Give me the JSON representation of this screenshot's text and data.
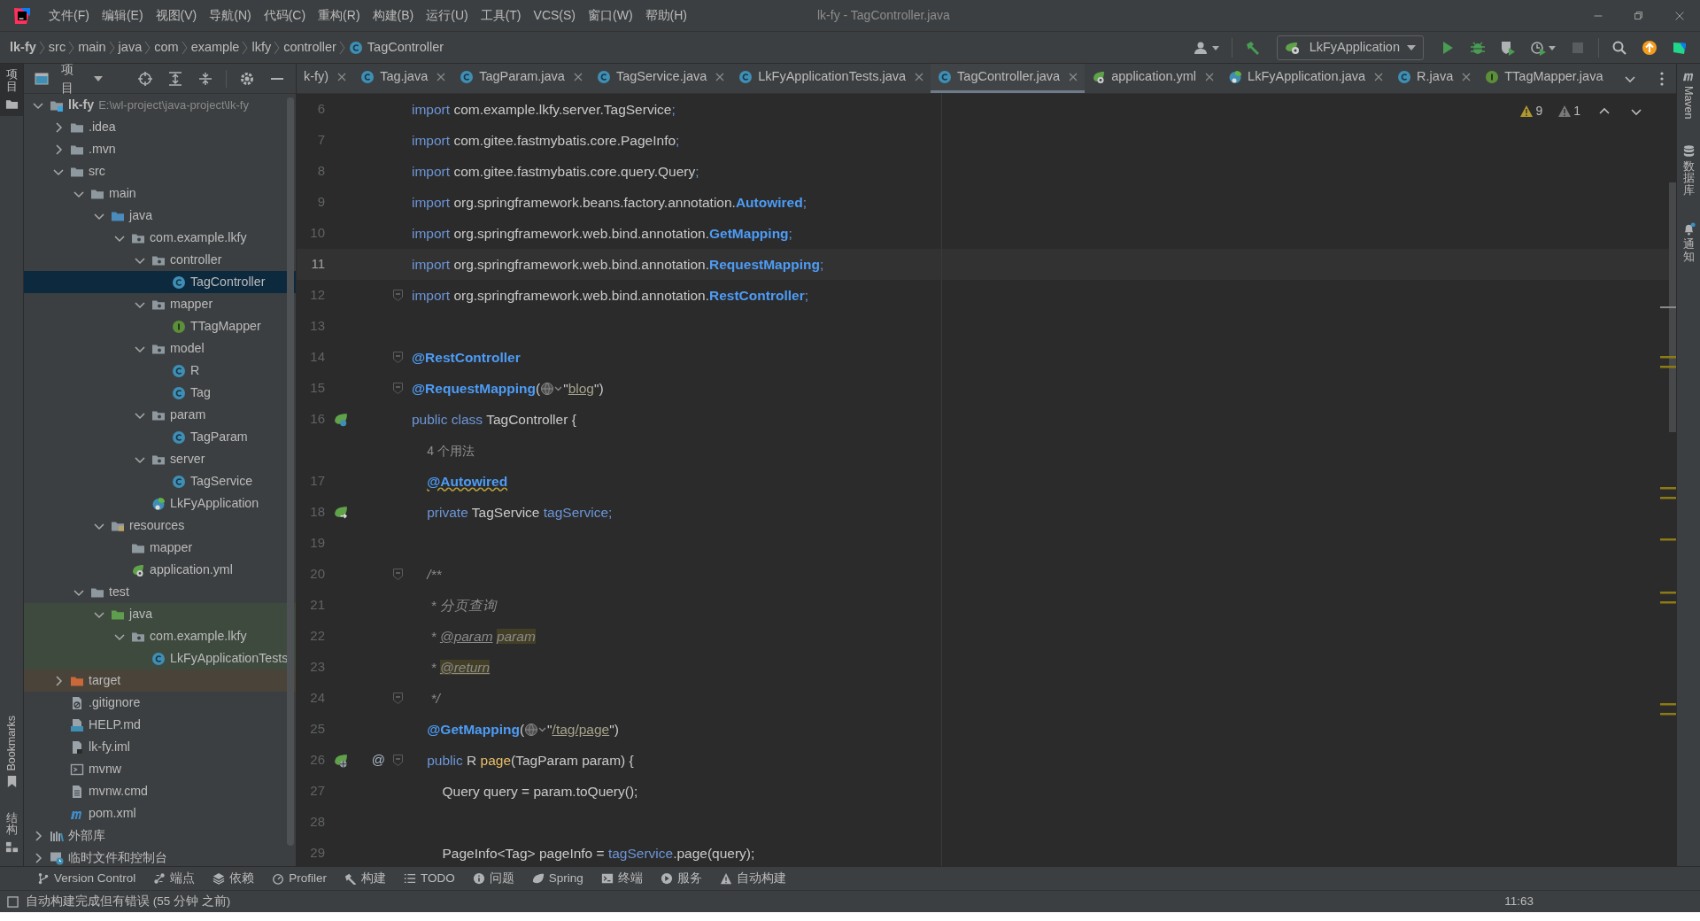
{
  "window": {
    "title": "lk-fy - TagController.java",
    "menu": [
      "文件(F)",
      "编辑(E)",
      "视图(V)",
      "导航(N)",
      "代码(C)",
      "重构(R)",
      "构建(B)",
      "运行(U)",
      "工具(T)",
      "VCS(S)",
      "窗口(W)",
      "帮助(H)"
    ]
  },
  "breadcrumb": [
    {
      "text": "lk-fy",
      "kind": "project"
    },
    {
      "text": "src",
      "kind": "plain"
    },
    {
      "text": "main",
      "kind": "plain"
    },
    {
      "text": "java",
      "kind": "plain"
    },
    {
      "text": "com",
      "kind": "plain"
    },
    {
      "text": "example",
      "kind": "plain"
    },
    {
      "text": "lkfy",
      "kind": "plain"
    },
    {
      "text": "controller",
      "kind": "plain"
    },
    {
      "text": "TagController",
      "kind": "class"
    }
  ],
  "toolbar": {
    "run_config": "LkFyApplication"
  },
  "left_strip": [
    {
      "label": "项目",
      "kind": "folder",
      "selected": true
    },
    {
      "label": "Bookmarks",
      "kind": "bookmark",
      "selected": false
    },
    {
      "label": "结构",
      "kind": "structure",
      "selected": false
    }
  ],
  "project_panel": {
    "title": "项目",
    "tree": [
      {
        "label": "lk-fy",
        "path": "E:\\wl-project\\java-project\\lk-fy",
        "kind": "project",
        "expanded": true,
        "selected": false,
        "children": [
          {
            "label": ".idea",
            "kind": "folder",
            "expanded": false,
            "selected": false
          },
          {
            "label": ".mvn",
            "kind": "folder",
            "expanded": false,
            "selected": false
          },
          {
            "label": "src",
            "kind": "folder",
            "expanded": true,
            "selected": false,
            "children": [
              {
                "label": "main",
                "kind": "folder",
                "expanded": true,
                "selected": false,
                "children": [
                  {
                    "label": "java",
                    "kind": "folder-source",
                    "expanded": true,
                    "selected": false,
                    "children": [
                      {
                        "label": "com.example.lkfy",
                        "kind": "package",
                        "expanded": true,
                        "selected": false,
                        "children": [
                          {
                            "label": "controller",
                            "kind": "package",
                            "expanded": true,
                            "selected": false,
                            "children": [
                              {
                                "label": "TagController",
                                "kind": "class",
                                "selected": true
                              }
                            ]
                          },
                          {
                            "label": "mapper",
                            "kind": "package",
                            "expanded": true,
                            "selected": false,
                            "children": [
                              {
                                "label": "TTagMapper",
                                "kind": "interface",
                                "selected": false
                              }
                            ]
                          },
                          {
                            "label": "model",
                            "kind": "package",
                            "expanded": true,
                            "selected": false,
                            "children": [
                              {
                                "label": "R",
                                "kind": "class",
                                "selected": false
                              },
                              {
                                "label": "Tag",
                                "kind": "class",
                                "selected": false
                              }
                            ]
                          },
                          {
                            "label": "param",
                            "kind": "package",
                            "expanded": true,
                            "selected": false,
                            "children": [
                              {
                                "label": "TagParam",
                                "kind": "class",
                                "selected": false
                              }
                            ]
                          },
                          {
                            "label": "server",
                            "kind": "package",
                            "expanded": true,
                            "selected": false,
                            "children": [
                              {
                                "label": "TagService",
                                "kind": "class",
                                "selected": false
                              }
                            ]
                          },
                          {
                            "label": "LkFyApplication",
                            "kind": "spring-class",
                            "selected": false
                          }
                        ]
                      }
                    ]
                  },
                  {
                    "label": "resources",
                    "kind": "resources",
                    "expanded": true,
                    "selected": false,
                    "children": [
                      {
                        "label": "mapper",
                        "kind": "folder",
                        "selected": false
                      },
                      {
                        "label": "application.yml",
                        "kind": "yml",
                        "selected": false
                      }
                    ]
                  }
                ]
              },
              {
                "label": "test",
                "kind": "folder",
                "expanded": true,
                "selected": false,
                "children": [
                  {
                    "label": "java",
                    "kind": "folder-test",
                    "expanded": true,
                    "selected": false,
                    "children": [
                      {
                        "label": "com.example.lkfy",
                        "kind": "package-test",
                        "expanded": true,
                        "selected": false,
                        "children": [
                          {
                            "label": "LkFyApplicationTests",
                            "kind": "class-test",
                            "selected": false
                          }
                        ]
                      }
                    ]
                  }
                ]
              }
            ]
          },
          {
            "label": "target",
            "kind": "folder-excluded",
            "expanded": false,
            "selected": false
          },
          {
            "label": ".gitignore",
            "kind": "gitignore",
            "selected": false
          },
          {
            "label": "HELP.md",
            "kind": "md",
            "selected": false
          },
          {
            "label": "lk-fy.iml",
            "kind": "iml",
            "selected": false
          },
          {
            "label": "mvnw",
            "kind": "shell",
            "selected": false
          },
          {
            "label": "mvnw.cmd",
            "kind": "text",
            "selected": false
          },
          {
            "label": "pom.xml",
            "kind": "maven",
            "selected": false
          }
        ]
      },
      {
        "label": "外部库",
        "kind": "library",
        "expanded": false,
        "selected": false
      },
      {
        "label": "临时文件和控制台",
        "kind": "scratch",
        "expanded": false,
        "selected": false
      }
    ]
  },
  "editor_tabs": [
    {
      "label": "k-fy)",
      "kind": "plain",
      "selected": false,
      "closable": true
    },
    {
      "label": "Tag.java",
      "kind": "class",
      "selected": false,
      "closable": true
    },
    {
      "label": "TagParam.java",
      "kind": "class",
      "selected": false,
      "closable": true
    },
    {
      "label": "TagService.java",
      "kind": "class",
      "selected": false,
      "closable": true
    },
    {
      "label": "LkFyApplicationTests.java",
      "kind": "class",
      "selected": false,
      "closable": true
    },
    {
      "label": "TagController.java",
      "kind": "class",
      "selected": true,
      "closable": true
    },
    {
      "label": "application.yml",
      "kind": "yml",
      "selected": false,
      "closable": true
    },
    {
      "label": "LkFyApplication.java",
      "kind": "spring-class",
      "selected": false,
      "closable": true
    },
    {
      "label": "R.java",
      "kind": "class",
      "selected": false,
      "closable": true
    },
    {
      "label": "TTagMapper.java",
      "kind": "interface",
      "selected": false,
      "closable": false
    }
  ],
  "inspections": {
    "warnings": "9",
    "weak_warnings": "1"
  },
  "code_lines": [
    {
      "number": "6",
      "current": false,
      "fold": false,
      "tokens": [
        {
          "kind": "keyword",
          "text": "import "
        },
        {
          "kind": "plain",
          "text": "com.example.lkfy.server.TagService"
        },
        {
          "kind": "keyword",
          "text": ";"
        }
      ]
    },
    {
      "number": "7",
      "current": false,
      "fold": false,
      "tokens": [
        {
          "kind": "keyword",
          "text": "import "
        },
        {
          "kind": "plain",
          "text": "com.gitee.fastmybatis.core.PageInfo"
        },
        {
          "kind": "keyword",
          "text": ";"
        }
      ]
    },
    {
      "number": "8",
      "current": false,
      "fold": false,
      "tokens": [
        {
          "kind": "keyword",
          "text": "import "
        },
        {
          "kind": "plain",
          "text": "com.gitee.fastmybatis.core.query.Query"
        },
        {
          "kind": "keyword",
          "text": ";"
        }
      ]
    },
    {
      "number": "9",
      "current": false,
      "fold": false,
      "tokens": [
        {
          "kind": "keyword",
          "text": "import "
        },
        {
          "kind": "plain",
          "text": "org.springframework.beans.factory.annotation."
        },
        {
          "kind": "annotation",
          "text": "Autowired"
        },
        {
          "kind": "keyword",
          "text": ";"
        }
      ]
    },
    {
      "number": "10",
      "current": false,
      "fold": false,
      "tokens": [
        {
          "kind": "keyword",
          "text": "import "
        },
        {
          "kind": "plain",
          "text": "org.springframework.web.bind.annotation."
        },
        {
          "kind": "annotation",
          "text": "GetMapping"
        },
        {
          "kind": "keyword",
          "text": ";"
        }
      ]
    },
    {
      "number": "11",
      "current": true,
      "fold": false,
      "tokens": [
        {
          "kind": "keyword",
          "text": "import "
        },
        {
          "kind": "plain",
          "text": "org.springframework.web.bind.annotation."
        },
        {
          "kind": "annotation",
          "text": "RequestMapping"
        },
        {
          "kind": "keyword",
          "text": ";"
        }
      ]
    },
    {
      "number": "12",
      "current": false,
      "fold": true,
      "tokens": [
        {
          "kind": "keyword",
          "text": "import "
        },
        {
          "kind": "plain",
          "text": "org.springframework.web.bind.annotation."
        },
        {
          "kind": "annotation",
          "text": "RestController"
        },
        {
          "kind": "keyword",
          "text": ";"
        }
      ]
    },
    {
      "number": "13",
      "current": false,
      "fold": false
    },
    {
      "number": "14",
      "current": false,
      "fold": true,
      "tokens": [
        {
          "kind": "annotation",
          "text": "@RestController"
        }
      ]
    },
    {
      "number": "15",
      "current": false,
      "fold": true,
      "tokens": [
        {
          "kind": "annotation",
          "text": "@RequestMapping"
        },
        {
          "kind": "plain",
          "text": "("
        },
        {
          "kind": "url-icon"
        },
        {
          "kind": "plain",
          "text": "\""
        },
        {
          "kind": "link",
          "text": "blog"
        },
        {
          "kind": "plain",
          "text": "\")"
        }
      ]
    },
    {
      "number": "16",
      "kind": "bean",
      "current": false,
      "fold": false,
      "tokens": [
        {
          "kind": "keyword",
          "text": "public class "
        },
        {
          "kind": "plain",
          "text": "TagController {"
        }
      ]
    },
    {
      "current": false,
      "fold": false,
      "tokens": [
        {
          "kind": "hint",
          "text": "    4 个用法"
        }
      ]
    },
    {
      "number": "17",
      "current": false,
      "fold": false,
      "tokens": [
        {
          "kind": "annotation-warn",
          "text": "    @Autowired"
        }
      ]
    },
    {
      "number": "18",
      "kind": "inject",
      "current": false,
      "fold": false,
      "tokens": [
        {
          "kind": "keyword",
          "text": "    private "
        },
        {
          "kind": "plain",
          "text": "TagService "
        },
        {
          "kind": "field",
          "text": "tagService"
        },
        {
          "kind": "keyword",
          "text": ";"
        }
      ]
    },
    {
      "number": "19",
      "current": false,
      "fold": false
    },
    {
      "number": "20",
      "current": false,
      "fold": true,
      "tokens": [
        {
          "kind": "comment",
          "text": "    /**"
        }
      ]
    },
    {
      "number": "21",
      "current": false,
      "fold": false,
      "tokens": [
        {
          "kind": "comment",
          "text": "     * 分页查询"
        }
      ]
    },
    {
      "number": "22",
      "current": false,
      "fold": false,
      "tokens": [
        {
          "kind": "comment",
          "text": "     * "
        },
        {
          "kind": "doctag",
          "text": "@param"
        },
        {
          "kind": "docparam",
          "text": " param"
        }
      ]
    },
    {
      "number": "23",
      "current": false,
      "fold": false,
      "tokens": [
        {
          "kind": "comment",
          "text": "     * "
        },
        {
          "kind": "doctag-marked",
          "text": "@return"
        }
      ]
    },
    {
      "number": "24",
      "current": false,
      "fold": true,
      "tokens": [
        {
          "kind": "comment",
          "text": "     */"
        }
      ]
    },
    {
      "number": "25",
      "current": false,
      "fold": false,
      "tokens": [
        {
          "kind": "annotation",
          "text": "    @GetMapping"
        },
        {
          "kind": "plain",
          "text": "("
        },
        {
          "kind": "url-icon"
        },
        {
          "kind": "plain",
          "text": "\""
        },
        {
          "kind": "link",
          "text": "/tag/page"
        },
        {
          "kind": "plain",
          "text": "\")"
        }
      ]
    },
    {
      "number": "26",
      "kind": "endpoint",
      "current": false,
      "fold": true,
      "marker": "@",
      "tokens": [
        {
          "kind": "keyword",
          "text": "    public "
        },
        {
          "kind": "plain",
          "text": "R "
        },
        {
          "kind": "method",
          "text": "page"
        },
        {
          "kind": "plain",
          "text": "(TagParam param) {"
        }
      ]
    },
    {
      "number": "27",
      "current": false,
      "fold": false,
      "tokens": [
        {
          "kind": "plain",
          "text": "        Query query = param.toQuery();"
        }
      ]
    },
    {
      "number": "28",
      "current": false,
      "fold": false
    },
    {
      "number": "29",
      "current": false,
      "fold": false,
      "tokens": [
        {
          "kind": "plain",
          "text": "        PageInfo<Tag> pageInfo = "
        },
        {
          "kind": "field",
          "text": "tagService"
        },
        {
          "kind": "plain",
          "text": ".page(query);"
        }
      ]
    }
  ],
  "right_strip": [
    {
      "label": "Maven",
      "kind": "maven",
      "badge": false
    },
    {
      "label": "数据库",
      "kind": "database",
      "badge": false
    },
    {
      "label": "通知",
      "kind": "bell",
      "badge": true
    }
  ],
  "tool_windows": [
    {
      "label": "Version Control",
      "kind": "branch"
    },
    {
      "label": "端点",
      "kind": "endpoints"
    },
    {
      "label": "依赖",
      "kind": "layers"
    },
    {
      "label": "Profiler",
      "kind": "gauge"
    },
    {
      "label": "构建",
      "kind": "hammer"
    },
    {
      "label": "TODO",
      "kind": "list"
    },
    {
      "label": "问题",
      "kind": "info"
    },
    {
      "label": "Spring",
      "kind": "leaf"
    },
    {
      "label": "终端",
      "kind": "terminal"
    },
    {
      "label": "服务",
      "kind": "play"
    },
    {
      "label": "自动构建",
      "kind": "warning"
    }
  ],
  "status_bar": {
    "message": "自动构建完成但有错误 (55 分钟 之前)",
    "time": "11:63"
  }
}
